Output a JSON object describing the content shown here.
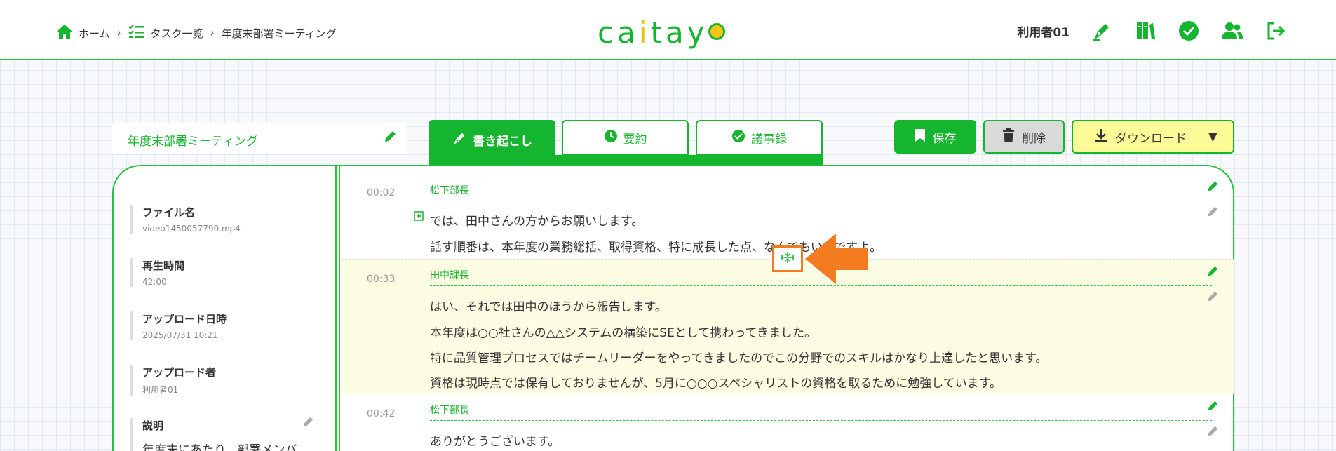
{
  "colors": {
    "accent": "#16b52f",
    "highlight": "#fdfde3",
    "callout": "#f47c20",
    "download_bg": "#fbfb97"
  },
  "breadcrumb": {
    "home": "ホーム",
    "tasks": "タスク一覧",
    "current": "年度末部署ミーティング"
  },
  "logo": {
    "text_left": "ca",
    "text_i": "i",
    "text_rest": "tay"
  },
  "header": {
    "user_name": "利用者01"
  },
  "doc": {
    "title": "年度末部署ミーティング"
  },
  "tabs": [
    {
      "label": "書き起こし",
      "icon": "pen-nib-icon",
      "active": true
    },
    {
      "label": "要約",
      "icon": "clock-icon",
      "active": false
    },
    {
      "label": "議事録",
      "icon": "check-circle-icon",
      "active": false
    }
  ],
  "actions": {
    "save": "保存",
    "delete": "削除",
    "download": "ダウンロード",
    "download_caret": "▼"
  },
  "sidebar": {
    "file_label": "ファイル名",
    "file_value": "video1450057790.mp4",
    "duration_label": "再生時間",
    "duration_value": "42:00",
    "uploaded_label": "アップロード日時",
    "uploaded_value": "2025/07/31 10:21",
    "uploader_label": "アップロード者",
    "uploader_value": "利用者01",
    "desc_label": "説明",
    "desc_value": "年度末にあたり、部署メンバ"
  },
  "segments": [
    {
      "time": "00:02",
      "speaker": "松下部長",
      "lines": [
        "では、田中さんの方からお願いします。",
        "話す順番は、本年度の業務総括、取得資格、特に成長した点、なんでもいいですよ。"
      ]
    },
    {
      "time": "00:33",
      "speaker": "田中課長",
      "lines": [
        "はい、それでは田中のほうから報告します。",
        "本年度は○○社さんの△△システムの構築にSEとして携わってきました。",
        "特に品質管理プロセスではチームリーダーをやってきましたのでこの分野でのスキルはかなり上達したと思います。",
        "資格は現時点では保有しておりませんが、5月に○○○スペシャリストの資格を取るために勉強しています。"
      ]
    },
    {
      "time": "00:42",
      "speaker": "松下部長",
      "lines": [
        "ありがとうございます。"
      ]
    }
  ]
}
